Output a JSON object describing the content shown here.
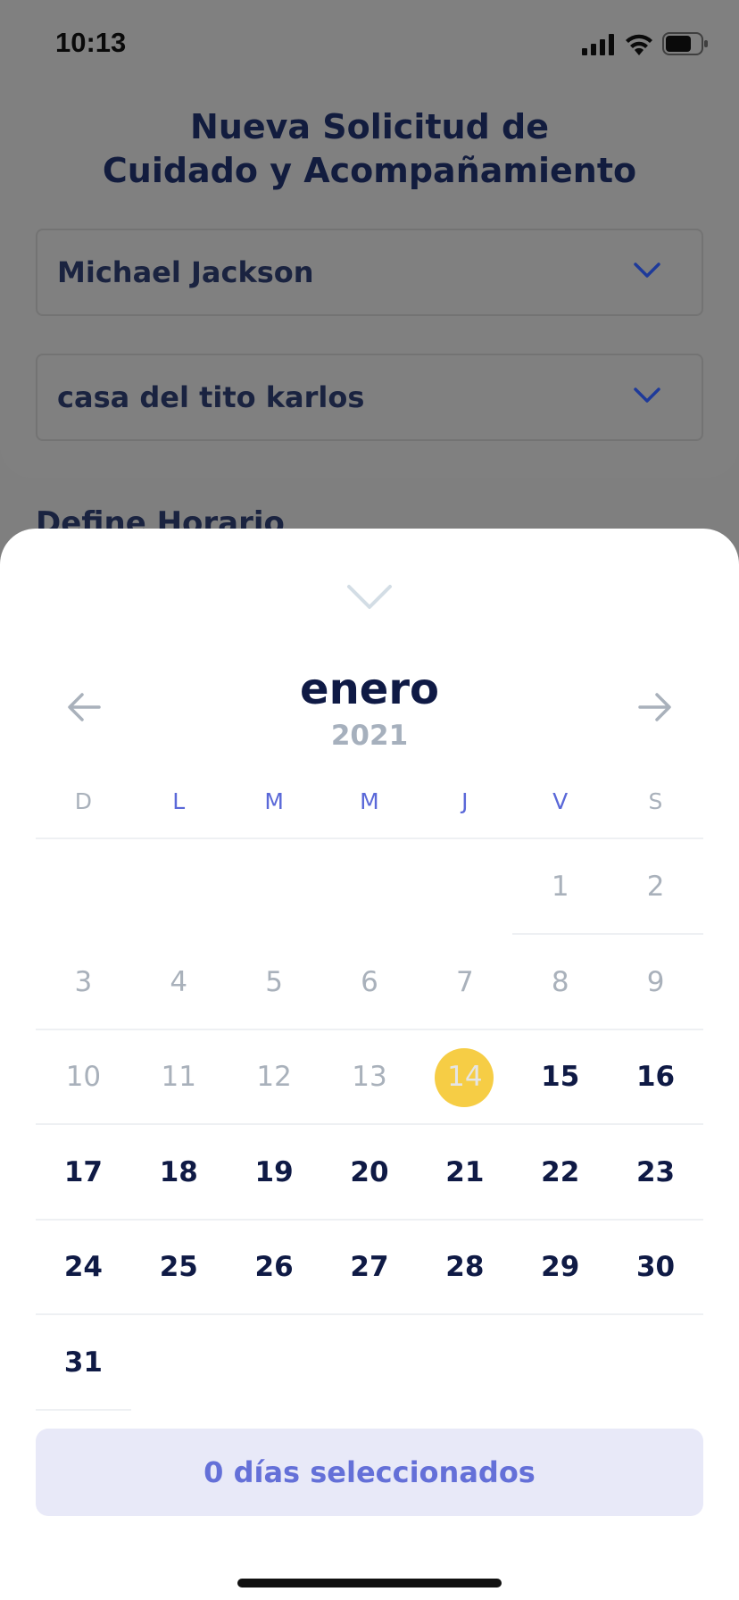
{
  "status_bar": {
    "time": "10:13",
    "icons": [
      "signal-icon",
      "wifi-icon",
      "battery-icon"
    ]
  },
  "background": {
    "title_line1": "Nueva Solicitud de",
    "title_line2": "Cuidado y Acompañamiento",
    "patient_select": {
      "value": "Michael Jackson"
    },
    "address_select": {
      "value": "casa del tito karlos"
    },
    "section_title": "Define Horario"
  },
  "calendar": {
    "month": "enero",
    "year": "2021",
    "weekdays": [
      "D",
      "L",
      "M",
      "M",
      "J",
      "V",
      "S"
    ],
    "weeks": [
      [
        "",
        "",
        "",
        "",
        "",
        "1",
        "2"
      ],
      [
        "3",
        "4",
        "5",
        "6",
        "7",
        "8",
        "9"
      ],
      [
        "10",
        "11",
        "12",
        "13",
        "14",
        "15",
        "16"
      ],
      [
        "17",
        "18",
        "19",
        "20",
        "21",
        "22",
        "23"
      ],
      [
        "24",
        "25",
        "26",
        "27",
        "28",
        "29",
        "30"
      ],
      [
        "31",
        "",
        "",
        "",
        "",
        "",
        ""
      ]
    ],
    "today": "14"
  },
  "selection_summary": "0 días seleccionados",
  "colors": {
    "accent": "#5a68d8",
    "today": "#f6cd45",
    "text_dark": "#0f1a45",
    "text_muted": "#a9b1bb"
  }
}
